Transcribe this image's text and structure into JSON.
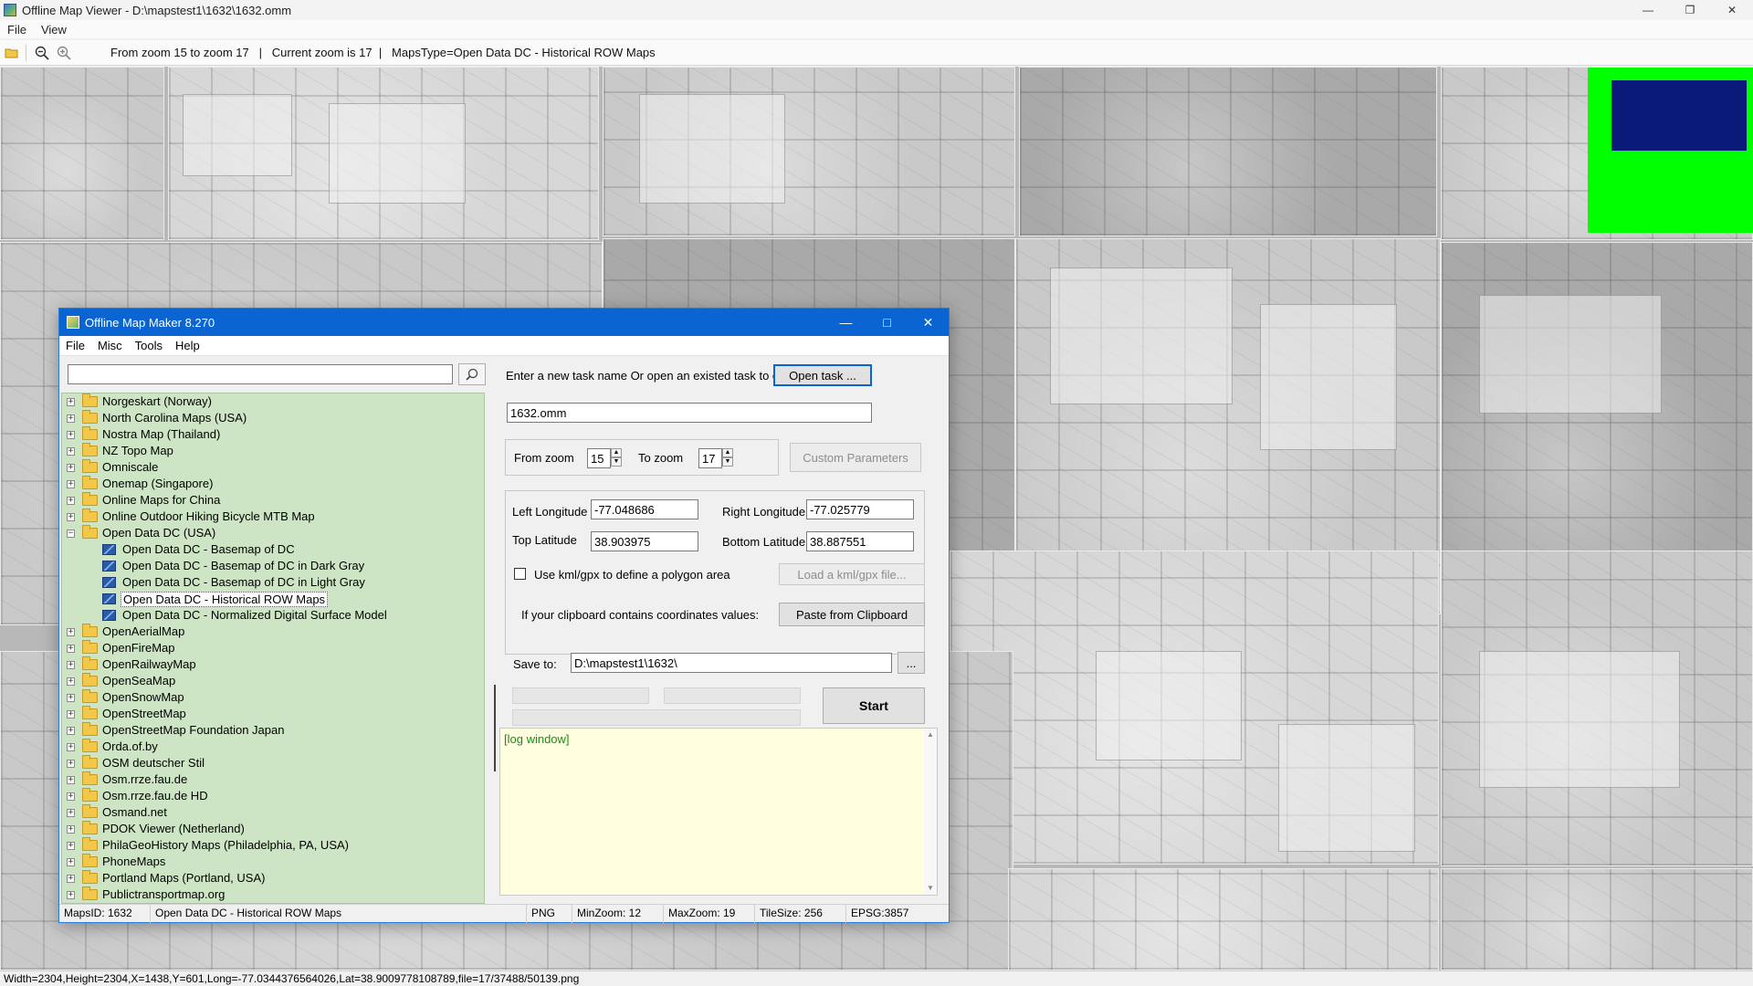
{
  "viewer": {
    "title": "Offline Map Viewer - D:\\mapstest1\\1632\\1632.omm",
    "menu": [
      "File",
      "View"
    ],
    "toolbar_info": "From zoom 15 to zoom 17   |   Current zoom is 17  |   MapsType=Open Data DC - Historical ROW Maps",
    "status": "Width=2304,Height=2304,X=1438,Y=601,Long=-77.0344376564026,Lat=38.9009778108789,file=17/37488/50139.png"
  },
  "icons": {
    "open_folder": "folder-open-icon",
    "zoom_out": "zoom-out-icon",
    "zoom_in": "zoom-in-icon",
    "search": "search-icon"
  },
  "overview_colors": {
    "background": "#00ff00",
    "viewport": "#0a1a7a"
  },
  "dialog": {
    "title": "Offline Map Maker 8.270",
    "menu": [
      "File",
      "Misc",
      "Tools",
      "Help"
    ],
    "search_value": "",
    "tree": [
      {
        "label": "Norgeskart (Norway)",
        "level": 0,
        "expanded": false
      },
      {
        "label": "North Carolina Maps (USA)",
        "level": 0,
        "expanded": false
      },
      {
        "label": "Nostra Map (Thailand)",
        "level": 0,
        "expanded": false
      },
      {
        "label": "NZ Topo Map",
        "level": 0,
        "expanded": false
      },
      {
        "label": "Omniscale",
        "level": 0,
        "expanded": false
      },
      {
        "label": "Onemap (Singapore)",
        "level": 0,
        "expanded": false
      },
      {
        "label": "Online Maps for China",
        "level": 0,
        "expanded": false
      },
      {
        "label": "Online Outdoor Hiking Bicycle MTB Map",
        "level": 0,
        "expanded": false
      },
      {
        "label": "Open Data DC (USA)",
        "level": 0,
        "expanded": true
      },
      {
        "label": "Open Data DC - Basemap of DC",
        "level": 1
      },
      {
        "label": "Open Data DC - Basemap of DC in Dark Gray",
        "level": 1
      },
      {
        "label": "Open Data DC - Basemap of DC in Light Gray",
        "level": 1
      },
      {
        "label": "Open Data DC - Historical ROW Maps",
        "level": 1,
        "selected": true
      },
      {
        "label": "Open Data DC - Normalized Digital Surface Model",
        "level": 1
      },
      {
        "label": "OpenAerialMap",
        "level": 0,
        "expanded": false
      },
      {
        "label": "OpenFireMap",
        "level": 0,
        "expanded": false
      },
      {
        "label": "OpenRailwayMap",
        "level": 0,
        "expanded": false
      },
      {
        "label": "OpenSeaMap",
        "level": 0,
        "expanded": false
      },
      {
        "label": "OpenSnowMap",
        "level": 0,
        "expanded": false
      },
      {
        "label": "OpenStreetMap",
        "level": 0,
        "expanded": false
      },
      {
        "label": "OpenStreetMap Foundation Japan",
        "level": 0,
        "expanded": false
      },
      {
        "label": "Orda.of.by",
        "level": 0,
        "expanded": false
      },
      {
        "label": "OSM deutscher Stil",
        "level": 0,
        "expanded": false
      },
      {
        "label": "Osm.rrze.fau.de",
        "level": 0,
        "expanded": false
      },
      {
        "label": "Osm.rrze.fau.de HD",
        "level": 0,
        "expanded": false
      },
      {
        "label": "Osmand.net",
        "level": 0,
        "expanded": false
      },
      {
        "label": "PDOK Viewer (Netherland)",
        "level": 0,
        "expanded": false
      },
      {
        "label": "PhilaGeoHistory Maps (Philadelphia, PA, USA)",
        "level": 0,
        "expanded": false
      },
      {
        "label": "PhoneMaps",
        "level": 0,
        "expanded": false
      },
      {
        "label": "Portland Maps (Portland, USA)",
        "level": 0,
        "expanded": false
      },
      {
        "label": "Publictransportmap.org",
        "level": 0,
        "expanded": false
      }
    ],
    "task_prompt": "Enter a new task name Or open an existed task to continue:",
    "open_task_label": "Open task ...",
    "task_name": "1632.omm",
    "from_zoom_label": "From zoom",
    "from_zoom": "15",
    "to_zoom_label": "To zoom",
    "to_zoom": "17",
    "custom_params_label": "Custom Parameters",
    "left_lon_label": "Left Longitude",
    "left_lon": "-77.048686",
    "right_lon_label": "Right Longitude",
    "right_lon": "-77.025779",
    "top_lat_label": "Top Latitude",
    "top_lat": "38.903975",
    "bottom_lat_label": "Bottom Latitude",
    "bottom_lat": "38.887551",
    "kml_label": "Use kml/gpx to define a polygon area",
    "load_kml_label": "Load a kml/gpx file...",
    "clipboard_prompt": "If your clipboard contains coordinates values:",
    "paste_label": "Paste from Clipboard",
    "save_to_label": "Save to:",
    "save_to": "D:\\mapstest1\\1632\\",
    "browse_label": "...",
    "start_label": "Start",
    "log_text": "[log window]",
    "status": {
      "maps_id": "MapsID: 1632",
      "maps_name": "Open Data DC - Historical ROW Maps",
      "format": "PNG",
      "min_zoom": "MinZoom: 12",
      "max_zoom": "MaxZoom: 19",
      "tile_size": "TileSize: 256",
      "epsg": "EPSG:3857"
    }
  }
}
